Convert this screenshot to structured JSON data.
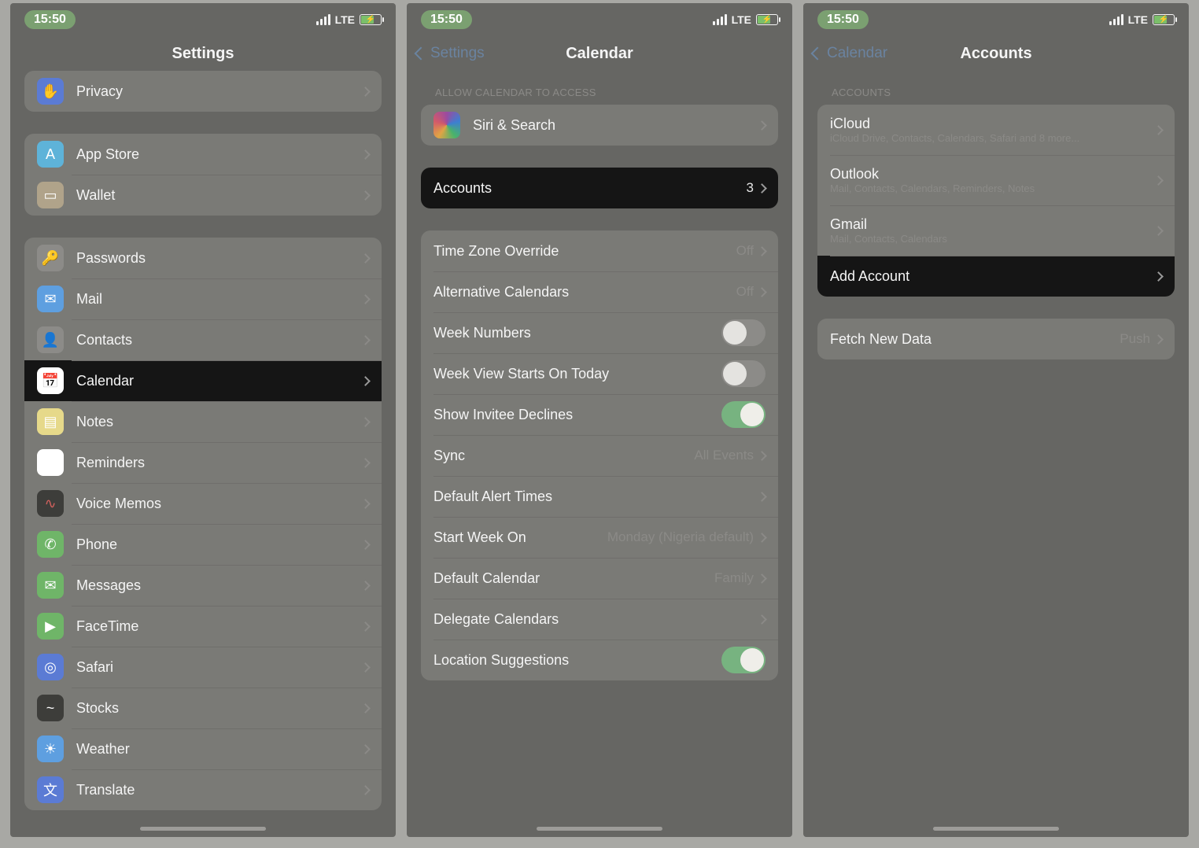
{
  "status": {
    "time": "15:50",
    "net": "LTE"
  },
  "screen1": {
    "title": "Settings",
    "groups": [
      {
        "rows": [
          {
            "id": "privacy",
            "label": "Privacy",
            "iconBg": "#5b7bd4",
            "glyph": "✋"
          }
        ]
      },
      {
        "rows": [
          {
            "id": "app-store",
            "label": "App Store",
            "iconBg": "#5eb3d9",
            "glyph": "A"
          },
          {
            "id": "wallet",
            "label": "Wallet",
            "iconBg": "#b0a38a",
            "glyph": "▭"
          }
        ]
      },
      {
        "rows": [
          {
            "id": "passwords",
            "label": "Passwords",
            "iconBg": "#8c8b88",
            "glyph": "🔑"
          },
          {
            "id": "mail",
            "label": "Mail",
            "iconBg": "#5e9fe0",
            "glyph": "✉"
          },
          {
            "id": "contacts",
            "label": "Contacts",
            "iconBg": "#8c8b88",
            "glyph": "👤"
          },
          {
            "id": "calendar",
            "label": "Calendar",
            "iconBg": "#ffffff",
            "glyph": "📅",
            "highlight": true
          },
          {
            "id": "notes",
            "label": "Notes",
            "iconBg": "#e6d98a",
            "glyph": "▤"
          },
          {
            "id": "reminders",
            "label": "Reminders",
            "iconBg": "#ffffff",
            "glyph": "⋮"
          },
          {
            "id": "voice-memos",
            "label": "Voice Memos",
            "iconBg": "#3d3d3a",
            "glyph": "∿",
            "glyphColor": "#d0605c"
          },
          {
            "id": "phone",
            "label": "Phone",
            "iconBg": "#6fb568",
            "glyph": "✆"
          },
          {
            "id": "messages",
            "label": "Messages",
            "iconBg": "#6fb568",
            "glyph": "✉"
          },
          {
            "id": "facetime",
            "label": "FaceTime",
            "iconBg": "#6fb568",
            "glyph": "▶"
          },
          {
            "id": "safari",
            "label": "Safari",
            "iconBg": "#5b7bd4",
            "glyph": "◎"
          },
          {
            "id": "stocks",
            "label": "Stocks",
            "iconBg": "#3d3d3a",
            "glyph": "~"
          },
          {
            "id": "weather",
            "label": "Weather",
            "iconBg": "#5e9fe0",
            "glyph": "☀"
          },
          {
            "id": "translate",
            "label": "Translate",
            "iconBg": "#5b7bd4",
            "glyph": "文"
          }
        ]
      }
    ]
  },
  "screen2": {
    "back": "Settings",
    "title": "Calendar",
    "allowHeader": "ALLOW CALENDAR TO ACCESS",
    "siri": "Siri & Search",
    "accounts": {
      "label": "Accounts",
      "count": "3"
    },
    "settings": [
      {
        "id": "tz",
        "label": "Time Zone Override",
        "value": "Off",
        "chev": true
      },
      {
        "id": "altcal",
        "label": "Alternative Calendars",
        "value": "Off",
        "chev": true
      },
      {
        "id": "weeknum",
        "label": "Week Numbers",
        "toggle": false
      },
      {
        "id": "weekview",
        "label": "Week View Starts On Today",
        "toggle": false
      },
      {
        "id": "invitee",
        "label": "Show Invitee Declines",
        "toggle": true
      },
      {
        "id": "sync",
        "label": "Sync",
        "value": "All Events",
        "chev": true
      },
      {
        "id": "alert",
        "label": "Default Alert Times",
        "chev": true
      },
      {
        "id": "startweek",
        "label": "Start Week On",
        "value": "Monday (Nigeria default)",
        "chev": true
      },
      {
        "id": "defcal",
        "label": "Default Calendar",
        "value": "Family",
        "chev": true
      },
      {
        "id": "delegate",
        "label": "Delegate Calendars",
        "chev": true
      },
      {
        "id": "locsug",
        "label": "Location Suggestions",
        "toggle": true
      }
    ]
  },
  "screen3": {
    "back": "Calendar",
    "title": "Accounts",
    "header": "ACCOUNTS",
    "accounts": [
      {
        "id": "icloud",
        "title": "iCloud",
        "sub": "iCloud Drive, Contacts, Calendars, Safari and 8 more..."
      },
      {
        "id": "outlook",
        "title": "Outlook",
        "sub": "Mail, Contacts, Calendars, Reminders, Notes"
      },
      {
        "id": "gmail",
        "title": "Gmail",
        "sub": "Mail, Contacts, Calendars"
      }
    ],
    "addAccount": "Add Account",
    "fetch": {
      "label": "Fetch New Data",
      "value": "Push"
    }
  }
}
